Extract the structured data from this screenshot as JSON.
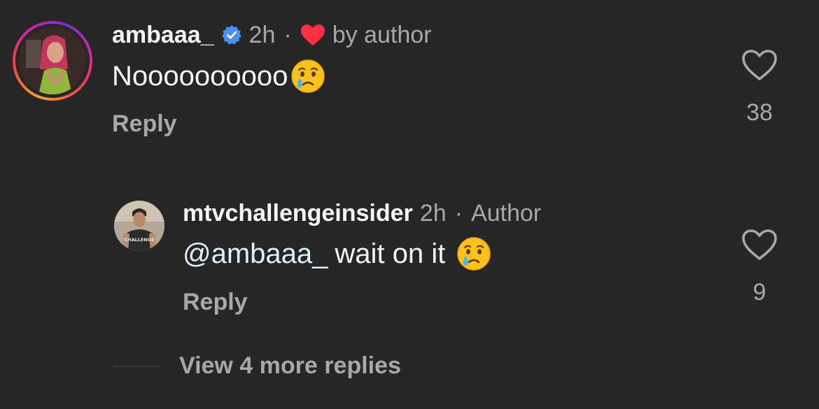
{
  "comments": [
    {
      "username": "ambaaa_",
      "verified": true,
      "time": "2h",
      "separator": "·",
      "liked_by_author_label": "by author",
      "text": "Noooooooooo",
      "emoji": "crying-face",
      "reply_label": "Reply",
      "like_count": "38"
    }
  ],
  "replies": [
    {
      "username": "mtvchallengeinsider",
      "time": "2h",
      "separator": "·",
      "author_label": "Author",
      "mention": "@ambaaa_",
      "text": "wait on it",
      "emoji": "crying-face",
      "reply_label": "Reply",
      "like_count": "9",
      "avatar_shirt_text": "CHALLENGE"
    }
  ],
  "view_more_label": "View 4 more replies",
  "colors": {
    "background": "#262626",
    "primary_text": "#f5f5f5",
    "secondary_text": "#a8a8a8",
    "mention": "#e0f1ff",
    "verified_blue": "#4a90f0",
    "heart_red": "#ff3040"
  }
}
